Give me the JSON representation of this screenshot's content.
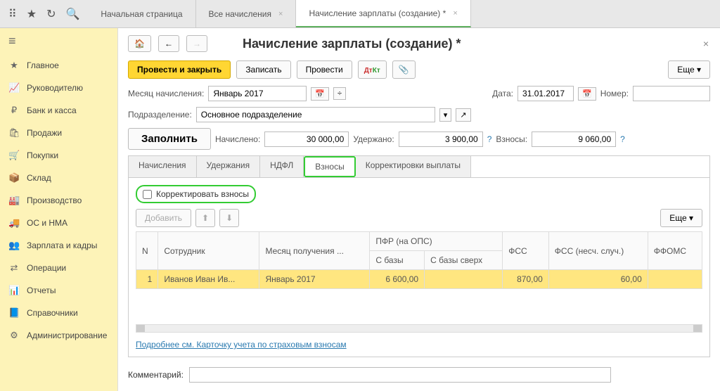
{
  "tabs": {
    "home": "Начальная страница",
    "all": "Все начисления",
    "current": "Начисление зарплаты (создание) *"
  },
  "sidebar": {
    "items": [
      {
        "label": "Главное"
      },
      {
        "label": "Руководителю"
      },
      {
        "label": "Банк и касса"
      },
      {
        "label": "Продажи"
      },
      {
        "label": "Покупки"
      },
      {
        "label": "Склад"
      },
      {
        "label": "Производство"
      },
      {
        "label": "ОС и НМА"
      },
      {
        "label": "Зарплата и кадры"
      },
      {
        "label": "Операции"
      },
      {
        "label": "Отчеты"
      },
      {
        "label": "Справочники"
      },
      {
        "label": "Администрирование"
      }
    ]
  },
  "page": {
    "title": "Начисление зарплаты (создание) *"
  },
  "toolbar": {
    "process_close": "Провести и закрыть",
    "save": "Записать",
    "process": "Провести",
    "more": "Еще"
  },
  "form": {
    "month_label": "Месяц начисления:",
    "month_value": "Январь 2017",
    "dept_label": "Подразделение:",
    "dept_value": "Основное подразделение",
    "date_label": "Дата:",
    "date_value": "31.01.2017",
    "number_label": "Номер:",
    "number_value": "",
    "fill": "Заполнить",
    "accrued_label": "Начислено:",
    "accrued_value": "30 000,00",
    "withheld_label": "Удержано:",
    "withheld_value": "3 900,00",
    "contrib_label": "Взносы:",
    "contrib_value": "9 060,00"
  },
  "doc_tabs": {
    "t1": "Начисления",
    "t2": "Удержания",
    "t3": "НДФЛ",
    "t4": "Взносы",
    "t5": "Корректировки выплаты"
  },
  "vz": {
    "correct_label": "Корректировать взносы",
    "add": "Добавить",
    "cols": {
      "n": "N",
      "emp": "Сотрудник",
      "month": "Месяц получения ...",
      "pfr": "ПФР (на ОПС)",
      "pfr_base": "С базы",
      "pfr_over": "С базы сверх",
      "fss": "ФСС",
      "fss_ns": "ФСС (несч. случ.)",
      "ffoms": "ФФОМС"
    },
    "rows": [
      {
        "n": "1",
        "emp": "Иванов Иван Ив...",
        "month": "Январь 2017",
        "pfr_base": "6 600,00",
        "pfr_over": "",
        "fss": "870,00",
        "fss_ns": "60,00"
      }
    ]
  },
  "link": "Подробнее см. Карточку учета по страховым взносам",
  "comment_label": "Комментарий:"
}
